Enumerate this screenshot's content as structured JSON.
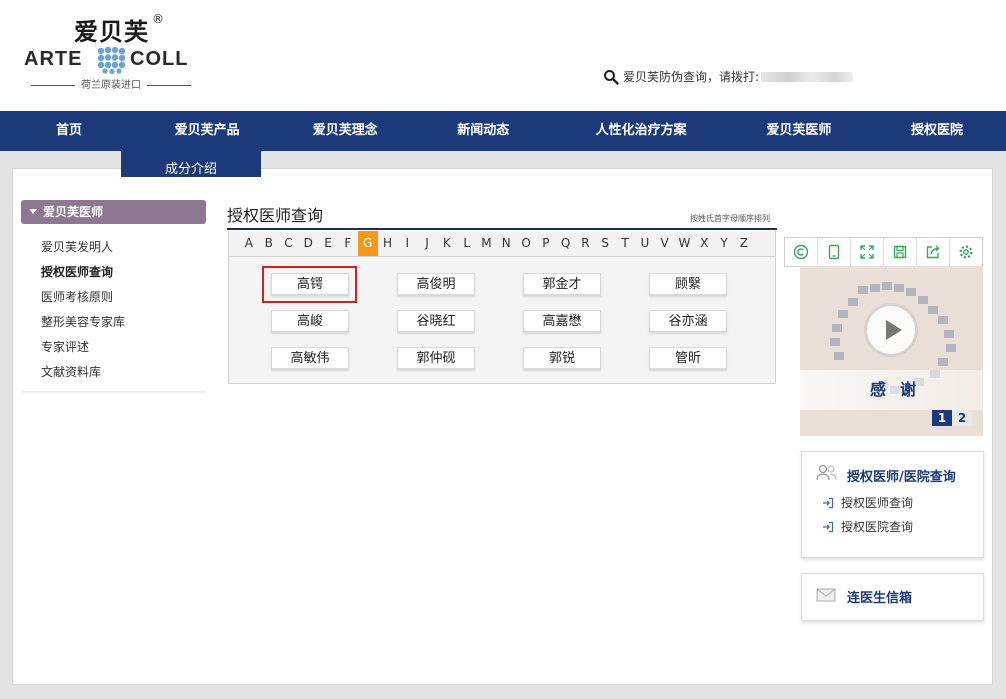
{
  "brand": {
    "cn": "爱贝芙",
    "reg": "®",
    "en_left": "ARTE",
    "en_right": "COLL",
    "tagline": "荷兰原装进口"
  },
  "hotline": {
    "label": "爱贝芙防伪查询，请拨打:"
  },
  "nav": [
    {
      "label": "首页",
      "width": 0.139
    },
    {
      "label": "爱贝芙产品"
    },
    {
      "label": "爱贝芙理念"
    },
    {
      "label": "新闻动态"
    },
    {
      "label": "人性化治疗方案"
    },
    {
      "label": "爱贝芙医师"
    },
    {
      "label": "授权医院"
    }
  ],
  "submenu": {
    "label": "成分介绍"
  },
  "sidebar": {
    "heading": "爱贝芙医师",
    "items": [
      {
        "label": "爱贝芙发明人",
        "active": false
      },
      {
        "label": "授权医师查询",
        "active": true
      },
      {
        "label": "医师考核原则",
        "active": false
      },
      {
        "label": "整形美容专家库",
        "active": false
      },
      {
        "label": "专家评述",
        "active": false
      },
      {
        "label": "文献资料库",
        "active": false
      }
    ]
  },
  "content": {
    "title": "授权医师查询",
    "note": "按姓氏首字母顺序排列",
    "letters": [
      "A",
      "B",
      "C",
      "D",
      "E",
      "F",
      "G",
      "H",
      "I",
      "J",
      "K",
      "L",
      "M",
      "N",
      "O",
      "P",
      "Q",
      "R",
      "S",
      "T",
      "U",
      "V",
      "W",
      "X",
      "Y",
      "Z"
    ],
    "active_letter": "G",
    "doctors": [
      [
        "高锷",
        "高俊明",
        "郭金才",
        "顾繄"
      ],
      [
        "高峻",
        "谷晓红",
        "高嘉懋",
        "谷亦涵"
      ],
      [
        "高敏伟",
        "郭仲砚",
        "郭锐",
        "管昕"
      ]
    ],
    "highlighted_doctor": "高锷"
  },
  "toolbar": {
    "icons": [
      "copyright-icon",
      "tablet-icon",
      "fullscreen-icon",
      "save-icon",
      "share-icon",
      "settings-icon"
    ]
  },
  "video": {
    "caption": "感谢",
    "pages": [
      "1",
      "2"
    ],
    "current_page": "1"
  },
  "query_card": {
    "title": "授权医师/医院查询",
    "links": [
      "授权医师查询",
      "授权医院查询"
    ]
  },
  "mail_card": {
    "title": "连医生信箱"
  },
  "colors": {
    "nav": "#1c3a7a",
    "active_letter": "#f39a1a",
    "sidebar_head": "#8e7891",
    "highlight": "#d0201f"
  }
}
